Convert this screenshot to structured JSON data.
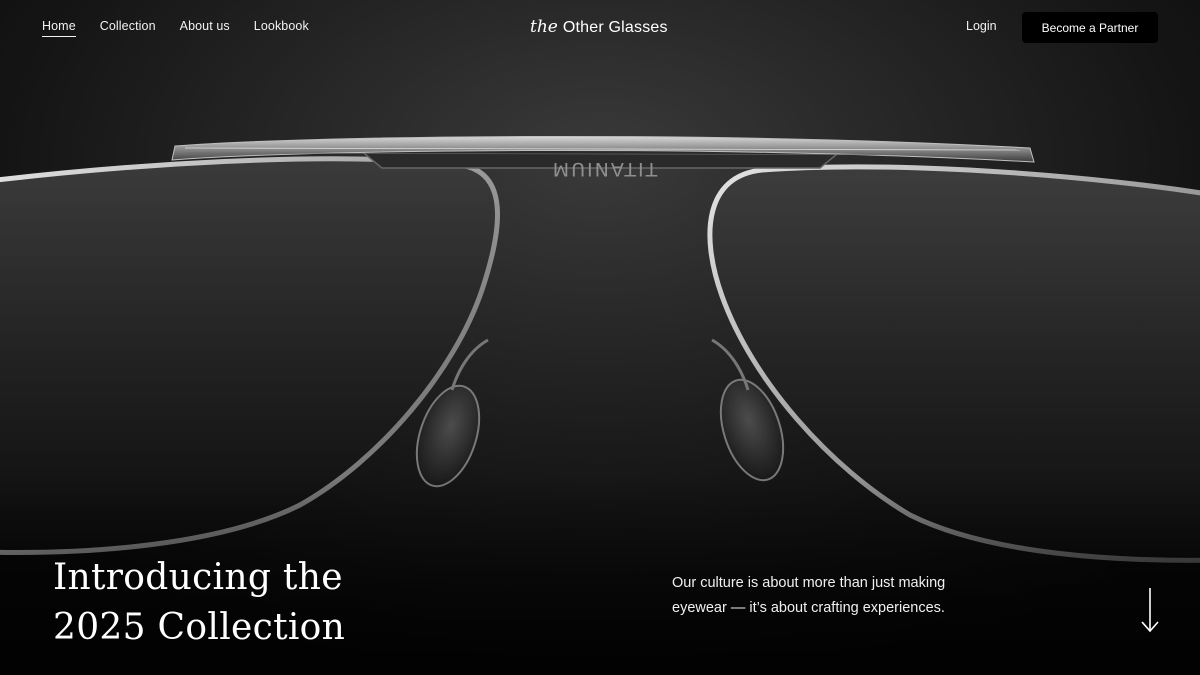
{
  "nav": {
    "links": [
      {
        "label": "Home",
        "active": true
      },
      {
        "label": "Collection",
        "active": false
      },
      {
        "label": "About us",
        "active": false
      },
      {
        "label": "Lookbook",
        "active": false
      }
    ]
  },
  "brand": {
    "prefix": "the",
    "name": "Other Glasses"
  },
  "actions": {
    "login_label": "Login",
    "partner_label": "Become a Partner"
  },
  "hero": {
    "title_line1": "Introducing the",
    "title_line2": "2025 Collection",
    "description": "Our culture is about more than just making eyewear — it’s about crafting experiences.",
    "engraving": "TITANIUM"
  },
  "icons": {
    "scroll": "arrow-down-icon"
  },
  "colors": {
    "background": "#0b0b0b",
    "text": "#ffffff",
    "button_bg": "#000000"
  }
}
